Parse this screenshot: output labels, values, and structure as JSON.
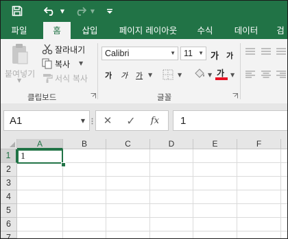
{
  "quick_access": {
    "more": "="
  },
  "tabs": [
    "파일",
    "홈",
    "삽입",
    "페이지 레이아웃",
    "수식",
    "데이터",
    "검"
  ],
  "ribbon": {
    "clipboard": {
      "paste_label": "붙여넣기",
      "cut_label": "잘라내기",
      "copy_label": "복사",
      "format_painter_label": "서식 복사",
      "group_label": "클립보드"
    },
    "font": {
      "font_name": "Calibri",
      "font_size": "11",
      "increase_size": "가",
      "decrease_size": "가",
      "bold": "가",
      "italic": "가",
      "underline": "가",
      "font_color": "가",
      "font_color_value": "#e81123",
      "group_label": "글꼴"
    }
  },
  "formula_bar": {
    "name_box": "A1",
    "cancel_icon": "✕",
    "enter_icon": "✓",
    "function_icon": "fx",
    "value": "1"
  },
  "sheet": {
    "columns": [
      "A",
      "B",
      "C",
      "D",
      "E",
      "F"
    ],
    "rows": [
      "1",
      "2",
      "3",
      "4",
      "5",
      "6",
      "7"
    ],
    "active_cell": "A1",
    "cells": {
      "A1": "1"
    }
  },
  "colors": {
    "accent": "#217346"
  }
}
